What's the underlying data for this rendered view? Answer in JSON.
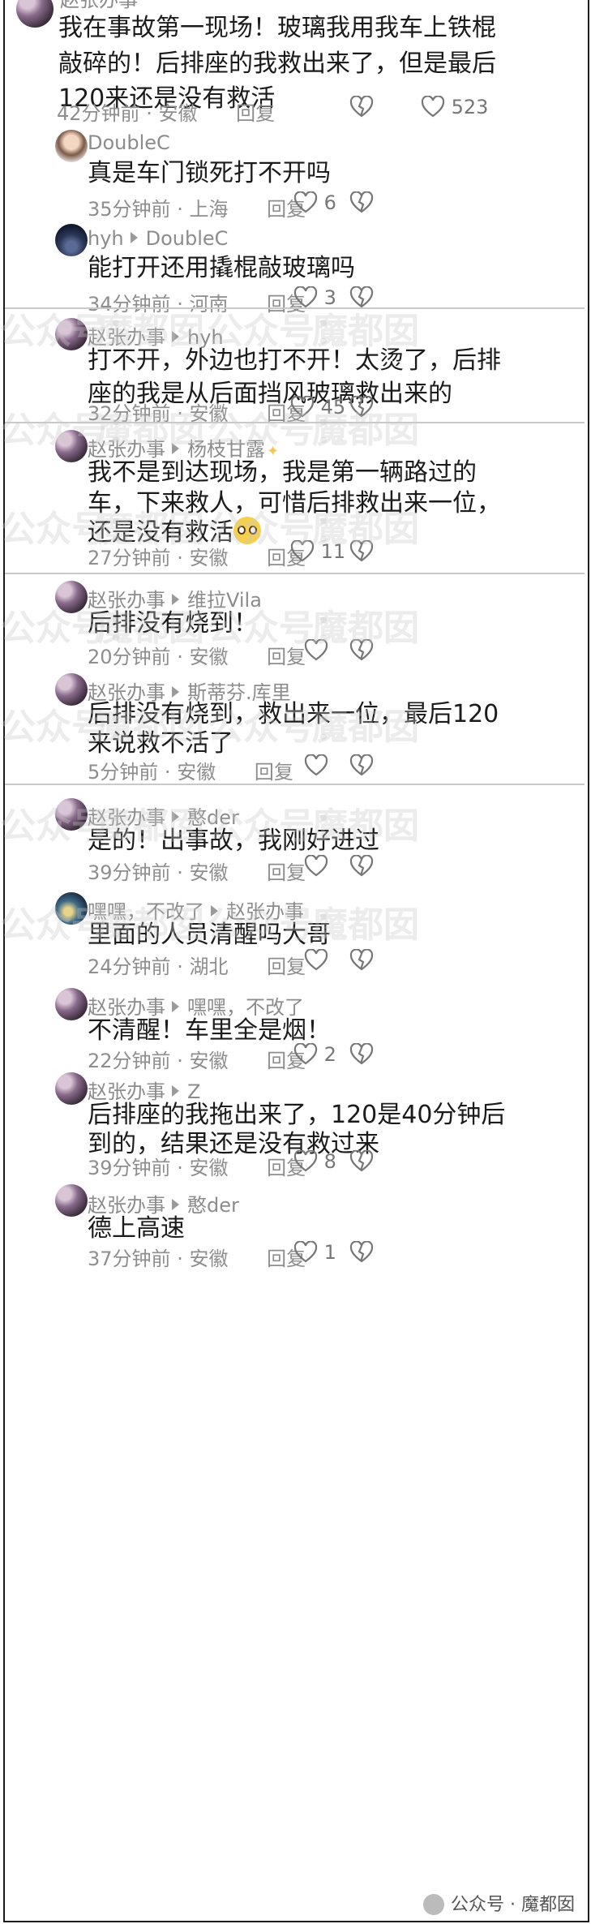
{
  "comments": [
    {
      "user": "赵张办事",
      "reply_to": "",
      "line1": "我在事故第一现场！玻璃我用我车上铁棍",
      "line2": "敲碎的！后排座的我救出来了，但是最后",
      "line3": "120来还是没有救活",
      "time": "42分钟前",
      "loc": "安徽",
      "reply": "回复",
      "likes": "523"
    },
    {
      "user": "DoubleC",
      "reply_to": "",
      "line1": "真是车门锁死打不开吗",
      "time": "35分钟前",
      "loc": "上海",
      "reply": "回复",
      "likes": "6"
    },
    {
      "user": "hyh",
      "reply_to": "DoubleC",
      "line1": "能打开还用撬棍敲玻璃吗",
      "time": "34分钟前",
      "loc": "河南",
      "reply": "回复",
      "likes": "3"
    },
    {
      "user": "赵张办事",
      "reply_to": "hyh",
      "line1": "打不开，外边也打不开！太烫了，后排",
      "line2": "座的我是从后面挡风玻璃救出来的",
      "time": "32分钟前",
      "loc": "安徽",
      "reply": "回复",
      "likes": "45"
    },
    {
      "user": "赵张办事",
      "reply_to": "杨枝甘露",
      "line1": "我不是到达现场，我是第一辆路过的",
      "line2": "车，下来救人，可惜后排救出来一位，",
      "line3": "还是没有救活",
      "time": "27分钟前",
      "loc": "安徽",
      "reply": "回复",
      "likes": "11"
    },
    {
      "user": "赵张办事",
      "reply_to": "维拉Vila",
      "line1": "后排没有烧到！",
      "time": "20分钟前",
      "loc": "安徽",
      "reply": "回复",
      "likes": ""
    },
    {
      "user": "赵张办事",
      "reply_to": "斯蒂芬.库里",
      "line1": "后排没有烧到，救出来一位，最后120",
      "line2": "来说救不活了",
      "time": "5分钟前",
      "loc": "安徽",
      "reply": "回复",
      "likes": ""
    },
    {
      "user": "赵张办事",
      "reply_to": "憨der",
      "line1": "是的！出事故，我刚好进过",
      "time": "39分钟前",
      "loc": "安徽",
      "reply": "回复",
      "likes": ""
    },
    {
      "user": "嘿嘿，不改了",
      "reply_to": "赵张办事",
      "line1": "里面的人员清醒吗大哥",
      "time": "24分钟前",
      "loc": "湖北",
      "reply": "回复",
      "likes": ""
    },
    {
      "user": "赵张办事",
      "reply_to": "嘿嘿，不改了",
      "line1": "不清醒！车里全是烟！",
      "time": "22分钟前",
      "loc": "安徽",
      "reply": "回复",
      "likes": "2"
    },
    {
      "user": "赵张办事",
      "reply_to": "Z",
      "line1": "后排座的我拖出来了，120是40分钟后",
      "line2": "到的，结果还是没有救过来",
      "time": "39分钟前",
      "loc": "安徽",
      "reply": "回复",
      "likes": "8"
    },
    {
      "user": "赵张办事",
      "reply_to": "憨der",
      "line1": "德上高速",
      "time": "37分钟前",
      "loc": "安徽",
      "reply": "回复",
      "likes": "1"
    }
  ],
  "meta_sep": "·",
  "watermark": {
    "text_a": "公众号：",
    "text_b": "魔都囡"
  },
  "footer": {
    "text": "公众号 · 魔都囡"
  },
  "colors": {
    "text": "#1b1b1b",
    "meta": "#8e8e8e",
    "divider": "#c9c9c9"
  }
}
